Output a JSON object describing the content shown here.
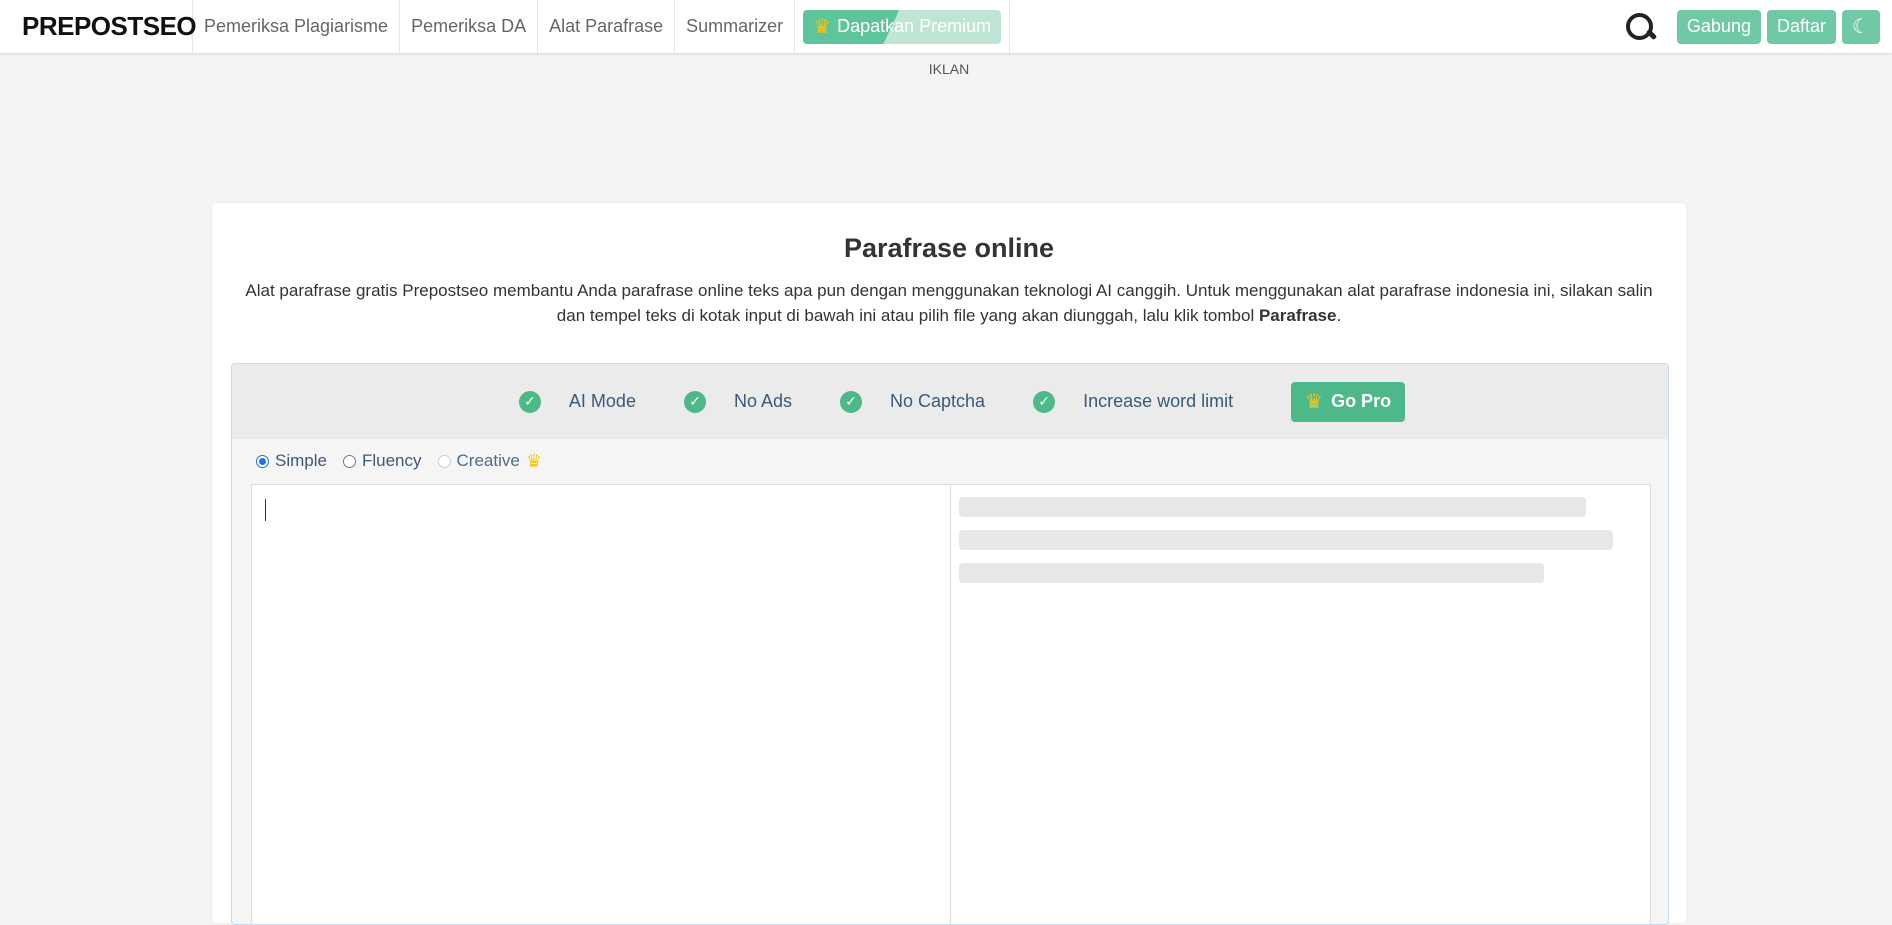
{
  "nav": {
    "logo": "PREPOSTSEO",
    "links": [
      "Pemeriksa Plagiarisme",
      "Pemeriksa DA",
      "Alat Parafrase",
      "Summarizer"
    ],
    "premium_label": "Dapatkan Premium",
    "join_label": "Gabung",
    "register_label": "Daftar"
  },
  "ad_label": "IKLAN",
  "main": {
    "title": "Parafrase online",
    "description_prefix": "Alat parafrase gratis Prepostseo membantu Anda parafrase online teks apa pun dengan menggunakan teknologi AI canggih. Untuk menggunakan alat parafrase indonesia ini, silakan salin dan tempel teks di kotak input di bawah ini atau pilih file yang akan diunggah, lalu klik tombol ",
    "description_bold": "Parafrase",
    "description_suffix": "."
  },
  "features": [
    "AI Mode",
    "No Ads",
    "No Captcha",
    "Increase word limit"
  ],
  "go_pro_label": "Go Pro",
  "modes": [
    {
      "label": "Simple",
      "selected": true
    },
    {
      "label": "Fluency",
      "selected": false
    },
    {
      "label": "Creative",
      "selected": false
    }
  ],
  "colors": {
    "accent": "#4db888",
    "premium": "#5ec49a",
    "nav_button": "#6fc9a4"
  },
  "icons": {
    "search": "search-icon",
    "moon": "moon-icon",
    "crown": "crown-icon",
    "check": "check-circle-icon"
  }
}
